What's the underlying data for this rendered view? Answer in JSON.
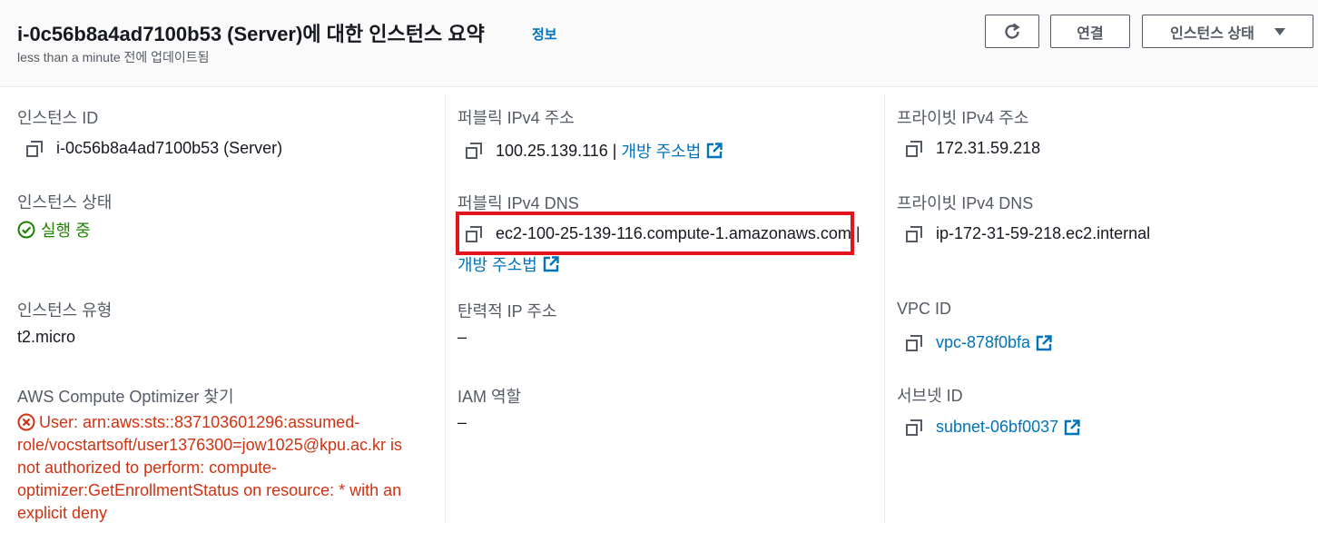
{
  "header": {
    "title": "i-0c56b8a4ad7100b53 (Server)에 대한 인스턴스 요약",
    "info_link": "정보",
    "updated": "less than a minute 전에 업데이트됨",
    "connect_label": "연결",
    "state_label": "인스턴스 상태"
  },
  "col1": {
    "instance_id_label": "인스턴스 ID",
    "instance_id_value": "i-0c56b8a4ad7100b53 (Server)",
    "state_label": "인스턴스 상태",
    "state_value": "실행 중",
    "type_label": "인스턴스 유형",
    "type_value": "t2.micro",
    "optimizer_label": "AWS Compute Optimizer 찾기",
    "optimizer_error": "User: arn:aws:sts::837103601296:assumed-role/vocstartsoft/user1376300=jow1025@kpu.ac.kr is not authorized to perform: compute-optimizer:GetEnrollmentStatus on resource: * with an explicit deny"
  },
  "col2": {
    "public_ip_label": "퍼블릭 IPv4 주소",
    "public_ip_value": "100.25.139.116",
    "open_address_link": "개방 주소법",
    "public_dns_label": "퍼블릭 IPv4 DNS",
    "public_dns_value": "ec2-100-25-139-116.compute-1.amazonaws.com",
    "elastic_ip_label": "탄력적 IP 주소",
    "elastic_ip_value": "–",
    "iam_label": "IAM 역할",
    "iam_value": "–"
  },
  "col3": {
    "private_ip_label": "프라이빗 IPv4 주소",
    "private_ip_value": "172.31.59.218",
    "private_dns_label": "프라이빗 IPv4 DNS",
    "private_dns_value": "ip-172-31-59-218.ec2.internal",
    "vpc_label": "VPC ID",
    "vpc_value": "vpc-878f0bfa",
    "subnet_label": "서브넷 ID",
    "subnet_value": "subnet-06bf0037"
  },
  "colors": {
    "link": "#0073bb",
    "success": "#1d8102",
    "error": "#d13212",
    "highlight": "#e3141e"
  },
  "icons": [
    "refresh-icon",
    "caret-down-icon",
    "copy-icon",
    "external-link-icon",
    "check-circle-icon",
    "error-circle-icon"
  ]
}
